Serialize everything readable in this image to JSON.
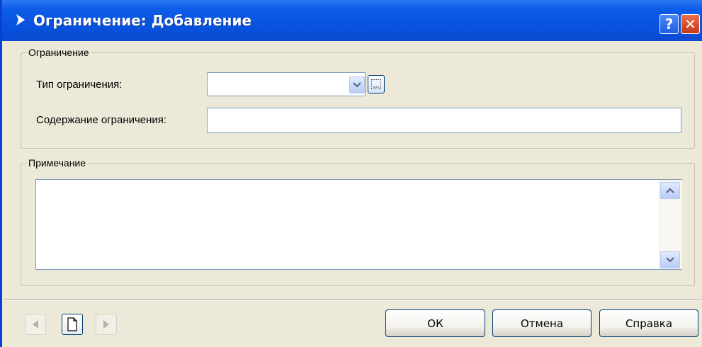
{
  "window": {
    "title": "Ограничение: Добавление",
    "help_label": "?",
    "close_label": "✕"
  },
  "restriction_group": {
    "legend": "Ограничение",
    "type_label": "Тип ограничения:",
    "type_value": "",
    "content_label": "Содержание ограничения:",
    "content_value": ""
  },
  "note_group": {
    "legend": "Примечание",
    "value": ""
  },
  "buttons": {
    "ok": "ОК",
    "cancel": "Отмена",
    "help": "Справка"
  },
  "icons": {
    "title": "arrow-right-icon",
    "prev": "triangle-left-icon",
    "new": "document-icon",
    "next": "triangle-right-icon",
    "dropdown": "chevron-down-icon",
    "lookup": "ellipsis-icon"
  },
  "colors": {
    "titlebar": "#0853e0",
    "window_bg": "#ece9d8",
    "field_border": "#7f9db9"
  }
}
